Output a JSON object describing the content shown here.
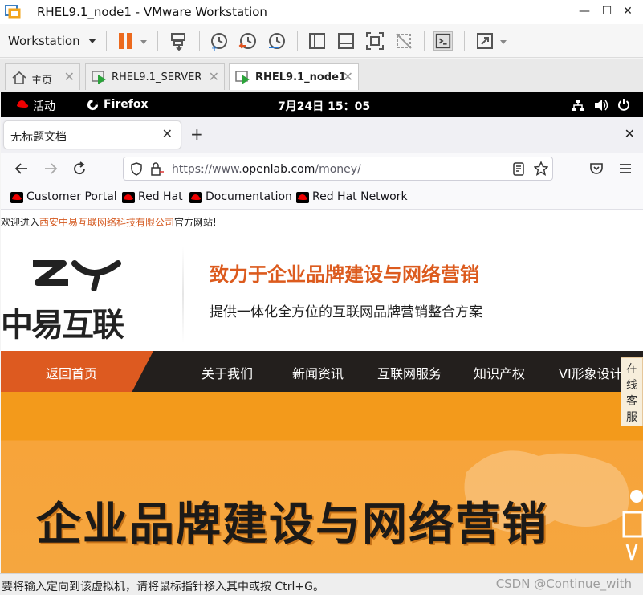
{
  "window": {
    "title": "RHEL9.1_node1 - VMware Workstation",
    "minimize_glyph": "—",
    "maximize_glyph": "☐",
    "close_glyph": "✕"
  },
  "vm_toolbar": {
    "workstation_label": "Workstation"
  },
  "vm_tabs": [
    {
      "label": "主页",
      "icon": "home-icon"
    },
    {
      "label": "RHEL9.1_SERVER",
      "icon": "vm-running-icon"
    },
    {
      "label": "RHEL9.1_node1",
      "icon": "vm-running-icon",
      "active": true
    }
  ],
  "gnome": {
    "activities": "活动",
    "app": "Firefox",
    "clock": "7月24日 15：05"
  },
  "firefox": {
    "tab_title": "无标题文档",
    "new_tab_glyph": "+",
    "tab_close_glyph": "✕",
    "window_close_glyph": "✕",
    "url_prefix": "https://www.",
    "url_domain": "openlab.com",
    "url_path": "/money/",
    "bookmarks": [
      "Customer Portal",
      "Red Hat",
      "Documentation",
      "Red Hat Network"
    ]
  },
  "webpage": {
    "welcome_pre": "欢迎进入",
    "welcome_company": "西安中易互联网络科技有限公司",
    "welcome_post": "官方网站!",
    "logo_text": "中易互联",
    "slogan": "致力于企业品牌建设与网络营销",
    "subtitle": "提供一体化全方位的互联网品牌营销整合方案",
    "menu": [
      "返回首页",
      "关于我们",
      "新闻资讯",
      "互联网服务",
      "知识产权",
      "VI形象设计"
    ],
    "online_service": "在线客服",
    "banner_title": "企业品牌建设与网络营销"
  },
  "status": {
    "message": "要将输入定向到该虚拟机，请将鼠标指针移入其中或按 Ctrl+G。",
    "watermark": "CSDN @Continue_with"
  },
  "colors": {
    "accent_orange": "#dc5b1e",
    "banner_orange": "#f39a1b",
    "menu_dark": "#231f1d",
    "redhat_red": "#ee0000"
  }
}
